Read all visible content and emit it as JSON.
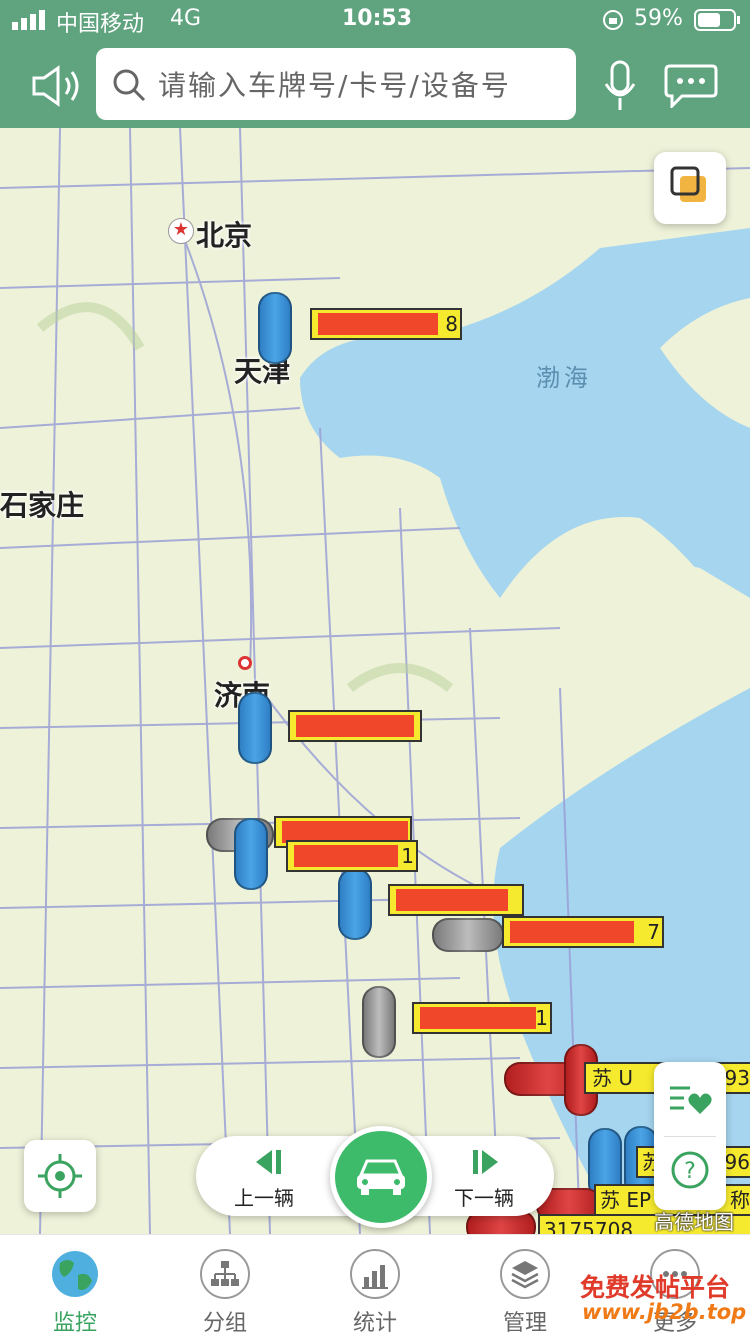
{
  "status_bar": {
    "carrier": "中国移动",
    "network": "4G",
    "time": "10:53",
    "battery": "59%"
  },
  "topbar": {
    "search_placeholder": "请输入车牌号/卡号/设备号",
    "icons": [
      "speaker-icon",
      "search-icon",
      "microphone-icon",
      "chat-icon"
    ]
  },
  "map": {
    "cities": {
      "beijing": "北京",
      "tianjin": "天津",
      "shijiazhuang": "石家庄",
      "jinan": "济南"
    },
    "sea": "渤海",
    "attribution": "高德地图",
    "plates": [
      {
        "tail": "8"
      },
      {
        "tail": ""
      },
      {
        "tail": ""
      },
      {
        "tail": "1"
      },
      {
        "tail": ""
      },
      {
        "tail": "7"
      },
      {
        "tail": "1"
      },
      {
        "tail": "苏 U",
        "tail2": "93"
      },
      {
        "tail": "苏",
        "tail2": "96"
      },
      {
        "tail": "苏 EP",
        "tail2": "称"
      },
      {
        "tail": "3175708"
      }
    ]
  },
  "nav": {
    "prev_label": "上一辆",
    "next_label": "下一辆"
  },
  "tabs": [
    {
      "label": "监控"
    },
    {
      "label": "分组"
    },
    {
      "label": "统计"
    },
    {
      "label": "管理"
    },
    {
      "label": "更多"
    }
  ],
  "watermark": {
    "line1": "免费发帖平台",
    "line2": "www.jb2b.top"
  },
  "colors": {
    "accent": "#5fa37f",
    "green": "#3dba6a",
    "plate": "#f6ea2e",
    "redact": "#f0462a",
    "sea": "#a6d5ef",
    "land": "#eef2d8"
  }
}
